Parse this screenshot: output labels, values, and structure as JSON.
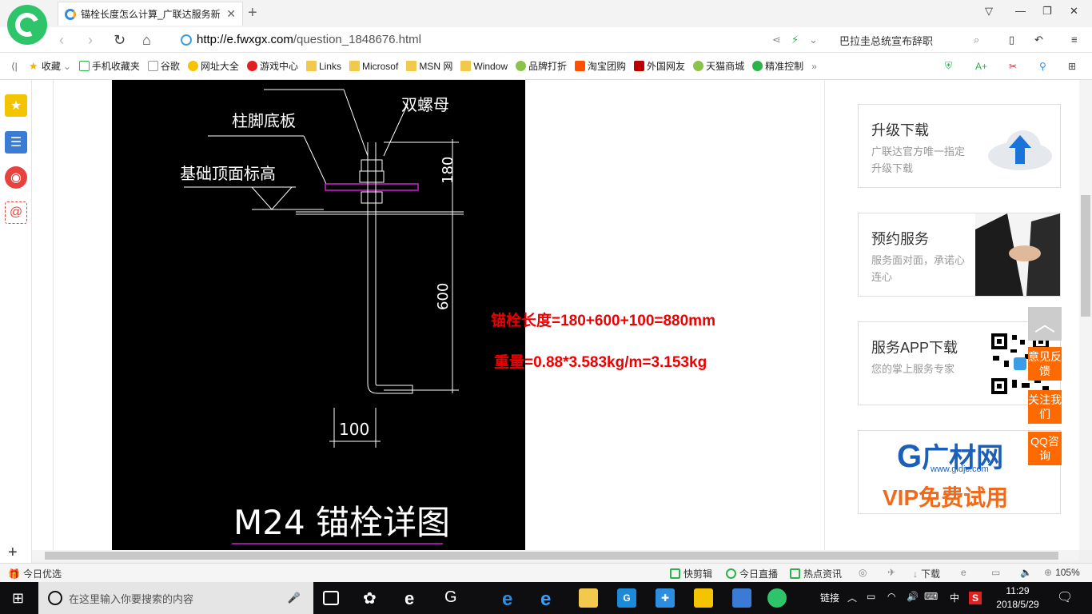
{
  "browser": {
    "tab_title": "锚栓长度怎么计算_广联达服务新",
    "url_host": "http://e.fwxgx.com",
    "url_path": "/question_1848676.html",
    "search_text": "巴拉圭总统宣布辞职"
  },
  "bookmarks": [
    {
      "label": "收藏",
      "icon": "star-icon"
    },
    {
      "label": "手机收藏夹",
      "icon": "phone-icon"
    },
    {
      "label": "谷歌",
      "icon": "page-icon"
    },
    {
      "label": "网址大全",
      "icon": "globe-icon"
    },
    {
      "label": "游戏中心",
      "icon": "game-icon"
    },
    {
      "label": "Links",
      "icon": "folder-icon"
    },
    {
      "label": "Microsof",
      "icon": "folder-icon"
    },
    {
      "label": "MSN 网",
      "icon": "folder-icon"
    },
    {
      "label": "Window",
      "icon": "folder-icon"
    },
    {
      "label": "品牌打折",
      "icon": "leaf-icon"
    },
    {
      "label": "淘宝团购",
      "icon": "taobao-icon"
    },
    {
      "label": "外国网友",
      "icon": "flag-icon"
    },
    {
      "label": "天猫商城",
      "icon": "leaf-icon"
    },
    {
      "label": "精准控制",
      "icon": "wechat-icon"
    }
  ],
  "drawing": {
    "top_label": "双螺母",
    "plate_label": "柱脚底板",
    "foundation_label": "基础顶面标高",
    "dim_180": "180",
    "dim_600": "600",
    "dim_100": "100",
    "caption": "M24 锚栓详图"
  },
  "answer": {
    "formula_length": "锚栓长度=180+600+100=880mm",
    "formula_weight": "重量=0.88*3.583kg/m=3.153kg"
  },
  "sidebar_cards": [
    {
      "title": "升级下载",
      "subtitle": "广联达官方唯一指定升级下载"
    },
    {
      "title": "预约服务",
      "subtitle": "服务面对面，承诺心连心"
    },
    {
      "title": "服务APP下载",
      "subtitle": "您的掌上服务专家"
    }
  ],
  "ad": {
    "brand": "广材网",
    "url": "www.gldjc.com",
    "slogan": "VIP免费试用"
  },
  "float_buttons": {
    "feedback": "意见反馈",
    "follow": "关注我们",
    "qq": "QQ咨询"
  },
  "statusbar": {
    "left": "今日优选",
    "items": [
      "快剪辑",
      "今日直播",
      "热点资讯",
      "下载"
    ],
    "zoom": "105%"
  },
  "taskbar": {
    "search_placeholder": "在这里输入你要搜索的内容",
    "link_label": "链接",
    "ime": "中",
    "time": "11:29",
    "date": "2018/5/29"
  },
  "colors": {
    "brand_green": "#2ec56a",
    "formula_red": "#ee0000",
    "float_orange": "#ff6a00"
  }
}
